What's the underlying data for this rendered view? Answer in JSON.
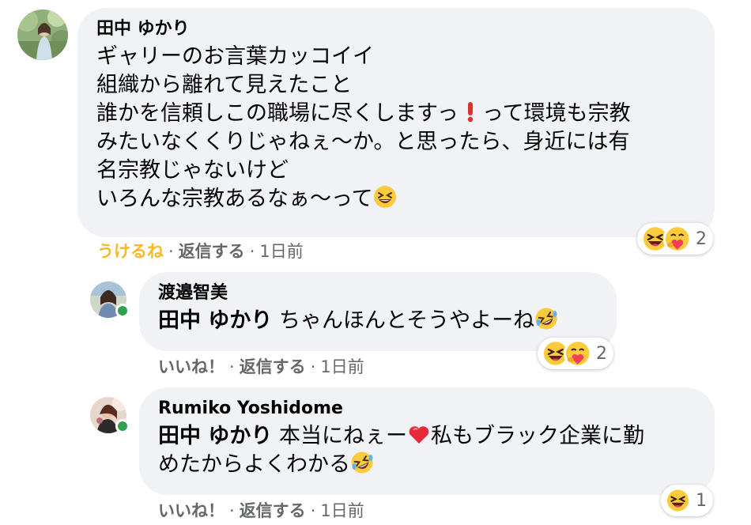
{
  "comments": [
    {
      "author": "田中 ゆかり",
      "lines": [
        "ギャリーのお言葉カッコイイ",
        "組織から離れて見えたこと",
        "誰かを信頼しこの職場に尽くしますっ",
        "って環境も宗教",
        "みたいなくくりじゃねぇ〜か。と思ったら、身近には有",
        "名宗教じゃないけど",
        "いろんな宗教あるなぁ〜って"
      ],
      "actions": {
        "reaction_label": "うけるね",
        "reply_label": "返信する",
        "time": "1日前",
        "sep": "·"
      },
      "reaction_count": "2",
      "reaction_icons": [
        "laughing-emoji",
        "care-emoji"
      ]
    },
    {
      "author": "渡邉智美",
      "mention": "田中 ゆかり",
      "text": " ちゃんほんとそうやよーね",
      "actions": {
        "like_label": "いいね！",
        "reply_label": "返信する",
        "time": "1日前",
        "sep": "·"
      },
      "reaction_count": "2",
      "reaction_icons": [
        "laughing-emoji",
        "care-emoji"
      ]
    },
    {
      "author": "Rumiko Yoshidome",
      "mention": "田中 ゆかり",
      "text_a": " 本当にねぇー",
      "text_b": "私もブラック企業に勤",
      "text_c": "めたからよくわかる",
      "actions": {
        "like_label": "いいね！",
        "reply_label": "返信する",
        "time": "1日前",
        "sep": "·"
      },
      "reaction_count": "1",
      "reaction_icons": [
        "laughing-emoji"
      ]
    }
  ],
  "colors": {
    "bubble": "#f0f2f5",
    "secondary_text": "#65676b",
    "haha_reaction": "#f7b928",
    "online": "#31a24c"
  }
}
